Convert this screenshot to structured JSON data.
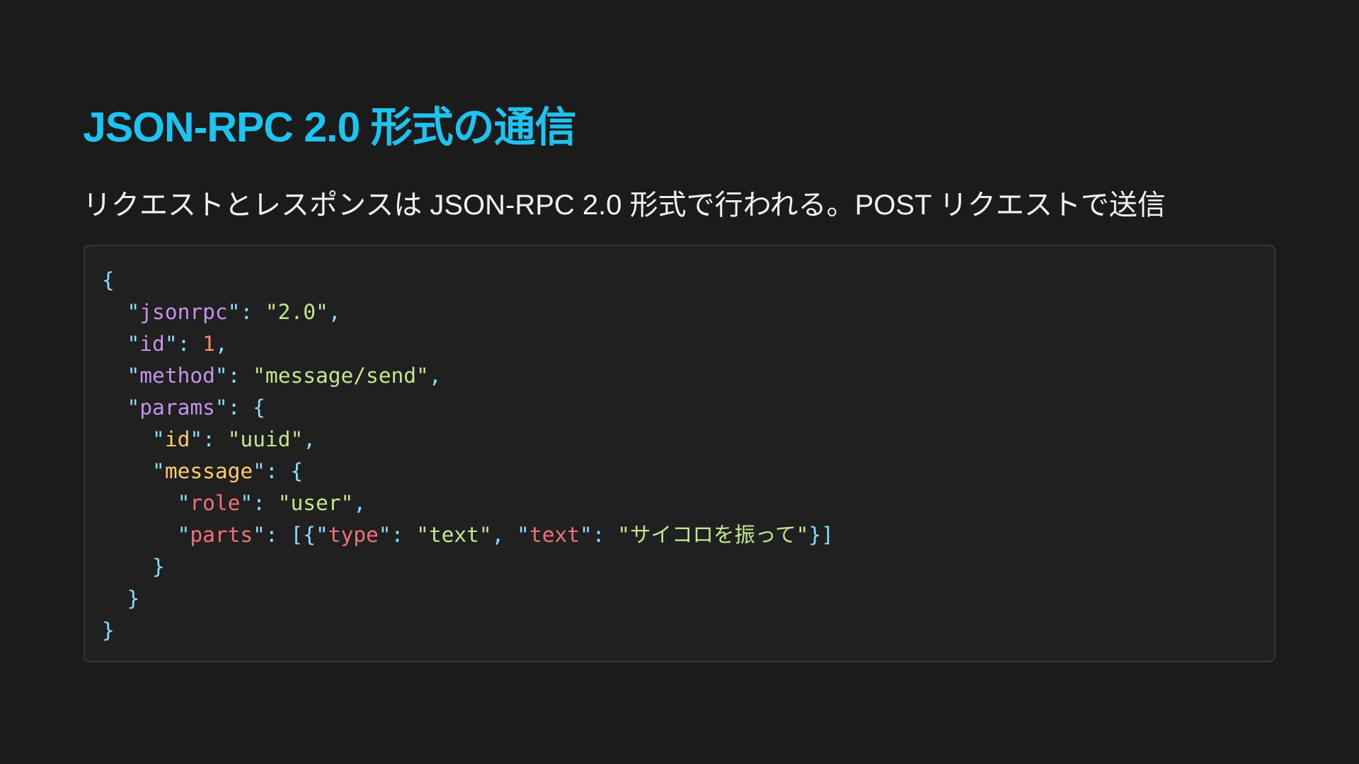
{
  "slide": {
    "title": "JSON-RPC 2.0 形式の通信",
    "subtitle": "リクエストとレスポンスは JSON-RPC 2.0 形式で行われる。POST リクエストで送信"
  },
  "colors": {
    "background": "#1b1b1c",
    "title": "#1ec3f0",
    "subtitle": "#f2f2f2",
    "code_panel": "#202021",
    "code_border": "#33363d",
    "punctuation": "#89ddff",
    "key_level1": "#c792ea",
    "key_level2": "#ffcb6b",
    "key_level3": "#f07178",
    "string": "#c3e88d",
    "number": "#f78c6c"
  },
  "code": {
    "lines": [
      [
        {
          "t": "{",
          "c": "punctuation"
        }
      ],
      [
        {
          "t": "  ",
          "c": "punctuation"
        },
        {
          "t": "\"",
          "c": "punctuation"
        },
        {
          "t": "jsonrpc",
          "c": "key_level1"
        },
        {
          "t": "\": ",
          "c": "punctuation"
        },
        {
          "t": "\"2.0\"",
          "c": "string"
        },
        {
          "t": ",",
          "c": "punctuation"
        }
      ],
      [
        {
          "t": "  ",
          "c": "punctuation"
        },
        {
          "t": "\"",
          "c": "punctuation"
        },
        {
          "t": "id",
          "c": "key_level1"
        },
        {
          "t": "\": ",
          "c": "punctuation"
        },
        {
          "t": "1",
          "c": "number"
        },
        {
          "t": ",",
          "c": "punctuation"
        }
      ],
      [
        {
          "t": "  ",
          "c": "punctuation"
        },
        {
          "t": "\"",
          "c": "punctuation"
        },
        {
          "t": "method",
          "c": "key_level1"
        },
        {
          "t": "\": ",
          "c": "punctuation"
        },
        {
          "t": "\"message/send\"",
          "c": "string"
        },
        {
          "t": ",",
          "c": "punctuation"
        }
      ],
      [
        {
          "t": "  ",
          "c": "punctuation"
        },
        {
          "t": "\"",
          "c": "punctuation"
        },
        {
          "t": "params",
          "c": "key_level1"
        },
        {
          "t": "\": {",
          "c": "punctuation"
        }
      ],
      [
        {
          "t": "    ",
          "c": "punctuation"
        },
        {
          "t": "\"",
          "c": "punctuation"
        },
        {
          "t": "id",
          "c": "key_level2"
        },
        {
          "t": "\": ",
          "c": "punctuation"
        },
        {
          "t": "\"uuid\"",
          "c": "string"
        },
        {
          "t": ",",
          "c": "punctuation"
        }
      ],
      [
        {
          "t": "    ",
          "c": "punctuation"
        },
        {
          "t": "\"",
          "c": "punctuation"
        },
        {
          "t": "message",
          "c": "key_level2"
        },
        {
          "t": "\": {",
          "c": "punctuation"
        }
      ],
      [
        {
          "t": "      ",
          "c": "punctuation"
        },
        {
          "t": "\"",
          "c": "punctuation"
        },
        {
          "t": "role",
          "c": "key_level3"
        },
        {
          "t": "\": ",
          "c": "punctuation"
        },
        {
          "t": "\"user\"",
          "c": "string"
        },
        {
          "t": ",",
          "c": "punctuation"
        }
      ],
      [
        {
          "t": "      ",
          "c": "punctuation"
        },
        {
          "t": "\"",
          "c": "punctuation"
        },
        {
          "t": "parts",
          "c": "key_level3"
        },
        {
          "t": "\": [{\"",
          "c": "punctuation"
        },
        {
          "t": "type",
          "c": "key_level3"
        },
        {
          "t": "\": ",
          "c": "punctuation"
        },
        {
          "t": "\"text\"",
          "c": "string"
        },
        {
          "t": ", \"",
          "c": "punctuation"
        },
        {
          "t": "text",
          "c": "key_level3"
        },
        {
          "t": "\": ",
          "c": "punctuation"
        },
        {
          "t": "\"サイコロを振って\"",
          "c": "string"
        },
        {
          "t": "}]",
          "c": "punctuation"
        }
      ],
      [
        {
          "t": "    }",
          "c": "punctuation"
        }
      ],
      [
        {
          "t": "  }",
          "c": "punctuation"
        }
      ],
      [
        {
          "t": "}",
          "c": "punctuation"
        }
      ]
    ]
  }
}
